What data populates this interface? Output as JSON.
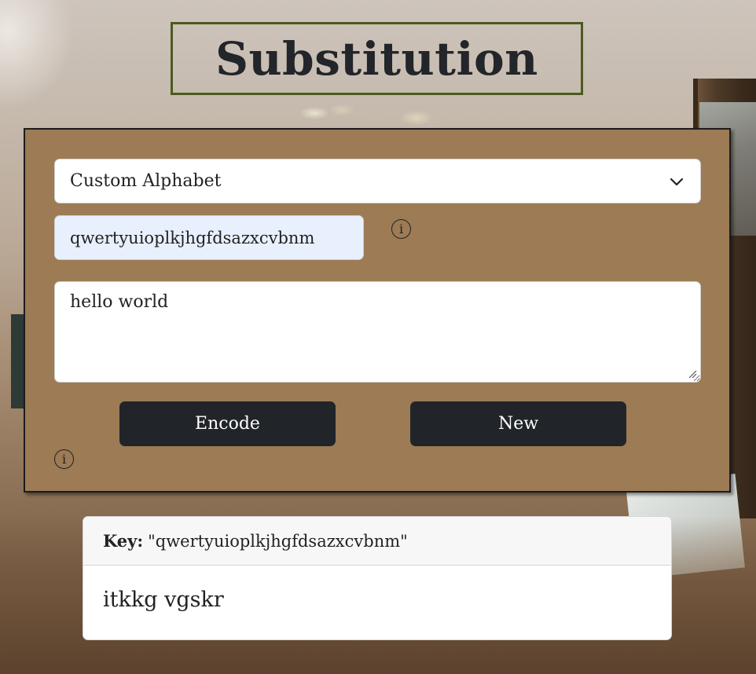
{
  "title": "Substitution",
  "form": {
    "select": {
      "selected": "Custom Alphabet"
    },
    "alphabet_input": {
      "value": "qwertyuioplkjhgfdsazxcvbnm"
    },
    "info_icon_glyph": "i",
    "message_textarea": {
      "value": "hello world"
    },
    "buttons": {
      "encode_label": "Encode",
      "new_label": "New"
    }
  },
  "result": {
    "key_label": "Key:",
    "key_value": "\"qwertyuioplkjhgfdsazxcvbnm\"",
    "output": "itkkg vgskr"
  },
  "colors": {
    "card_bg": "#9c7b55",
    "title_border": "#4b5a1e",
    "button_bg": "#212529",
    "input_autofill_bg": "#e8f0fe"
  },
  "icons": [
    "chevron-down-icon",
    "info-icon",
    "resize-grip-icon"
  ]
}
